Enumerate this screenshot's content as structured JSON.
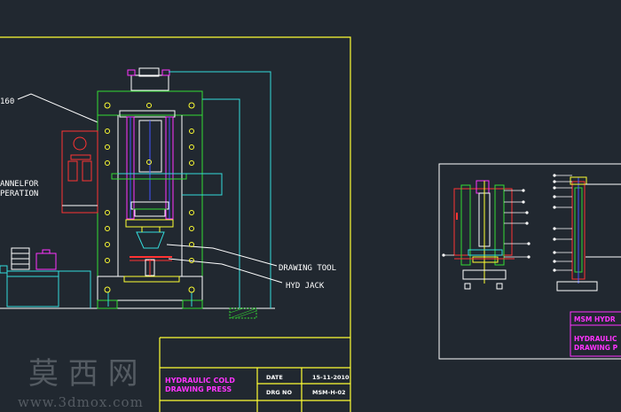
{
  "viewport": {
    "background": "#212830"
  },
  "main_view": {
    "labels": {
      "size_callout": "160",
      "panel_line1": "ANNELFOR",
      "panel_line2": "PERATION",
      "drawing_tool": "DRAWING TOOL",
      "hyd_jack": "HYD JACK"
    }
  },
  "title_block": {
    "title_line1": "HYDRAULIC COLD",
    "title_line2": "DRAWING PRESS",
    "date_label": "DATE",
    "date_value": "15-11-2010",
    "drg_label": "DRG NO",
    "drg_value": "MSM-H-02"
  },
  "sheet2": {
    "title_block": {
      "header": "MSM HYDR",
      "title_line1": "HYDRAULIC",
      "title_line2": "DRAWING P"
    }
  },
  "watermark": {
    "chars": "莫 西 网",
    "url": "www.3dmox.com"
  },
  "colors": {
    "frame": "#ffff33",
    "white": "#ffffff",
    "green": "#33dd33",
    "cyan": "#33dddd",
    "magenta": "#ff33ff",
    "red": "#ff3333",
    "blue": "#4455ff",
    "grey": "#9aa0a6"
  }
}
